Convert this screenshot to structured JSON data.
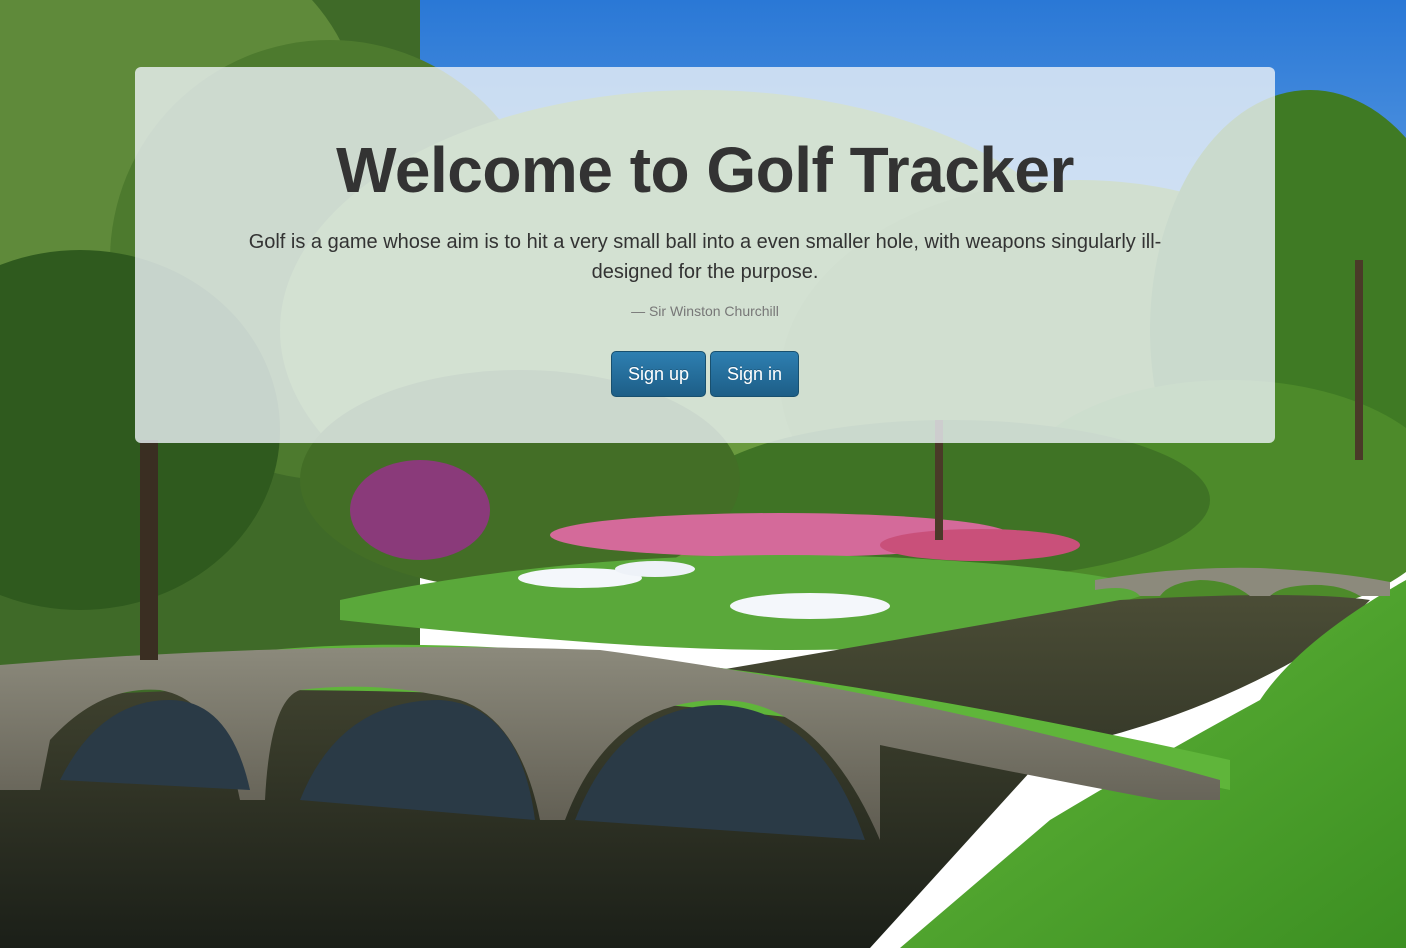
{
  "hero": {
    "title": "Welcome to Golf Tracker",
    "quote": "Golf is a game whose aim is to hit a very small ball into a even smaller hole, with weapons singularly ill-designed for the purpose.",
    "author": "— Sir Winston Churchill"
  },
  "actions": {
    "signup_label": "Sign up",
    "signin_label": "Sign in"
  },
  "colors": {
    "button": "#22658f",
    "title": "#333333",
    "panel": "#eef2f8"
  }
}
